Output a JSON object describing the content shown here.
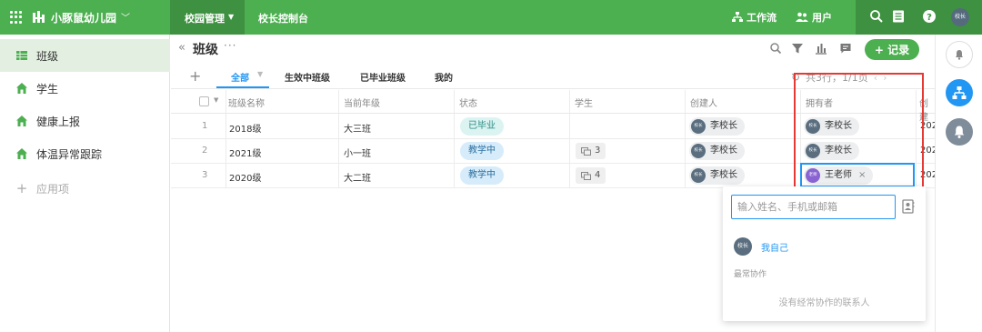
{
  "topbar": {
    "app_name": "小豚鼠幼儿园",
    "nav": [
      "校园管理",
      "校长控制台"
    ],
    "workflow_label": "工作流",
    "users_label": "用户",
    "avatar_text": "校长"
  },
  "sidebar": {
    "items": [
      {
        "label": "班级",
        "icon": "grid-table-icon"
      },
      {
        "label": "学生",
        "icon": "house-icon"
      },
      {
        "label": "健康上报",
        "icon": "house-icon"
      },
      {
        "label": "体温异常跟踪",
        "icon": "house-icon"
      }
    ],
    "add_label": "应用项"
  },
  "page": {
    "collapse_glyph": "«",
    "title": "班级",
    "more_glyph": "···",
    "add_record_label": "+ 记录",
    "tabs": [
      "全部",
      "生效中班级",
      "已毕业班级",
      "我的"
    ],
    "add_tab_glyph": "+",
    "pager_text": "共3行，1/1页"
  },
  "table": {
    "columns": [
      "班级名称",
      "当前年级",
      "状态",
      "学生",
      "创建人",
      "拥有者",
      "创建"
    ],
    "rows": [
      {
        "num": "1",
        "name": "2018级",
        "grade": "大三班",
        "status": "已毕业",
        "students": "",
        "creator": "李校长",
        "owner": "李校长",
        "peek": "202"
      },
      {
        "num": "2",
        "name": "2021级",
        "grade": "小一班",
        "status": "教学中",
        "students": "3",
        "creator": "李校长",
        "owner": "李校长",
        "peek": "202"
      },
      {
        "num": "3",
        "name": "2020级",
        "grade": "大二班",
        "status": "教学中",
        "students": "4",
        "creator": "李校长",
        "owner": "王老师",
        "peek": "202"
      }
    ],
    "avatar_text": "校长",
    "teacher_avatar_text": "老师"
  },
  "popup": {
    "placeholder": "输入姓名、手机或邮箱",
    "self_avatar_text": "校长",
    "self_label": "我自己",
    "section_label": "最常协作",
    "empty_text": "没有经常协作的联系人"
  },
  "colors": {
    "brand": "#4caf50",
    "brand_dark": "#3d9140",
    "accent": "#2196f3",
    "highlight": "#e53935"
  }
}
